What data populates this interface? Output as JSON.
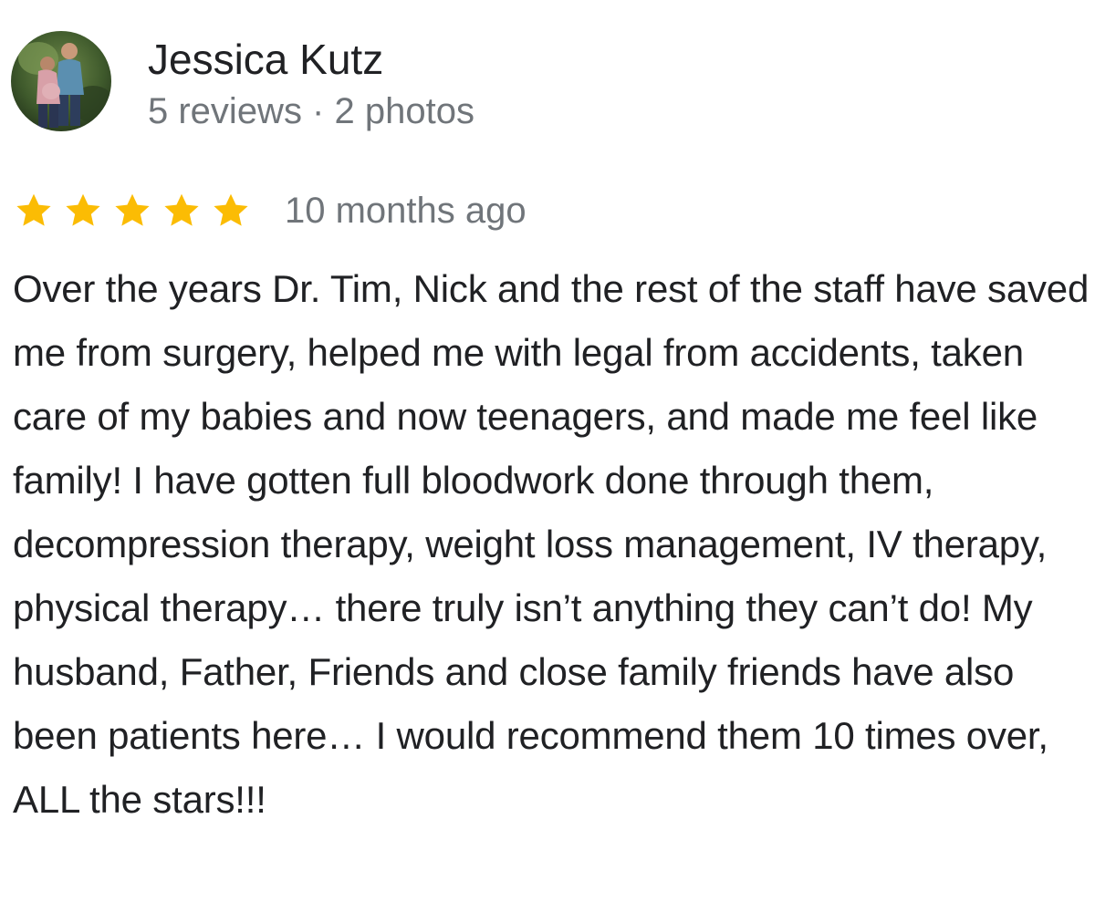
{
  "reviewer": {
    "name": "Jessica Kutz",
    "meta": "5 reviews · 2 photos",
    "avatar_icon": "profile-photo-avatar"
  },
  "rating": {
    "stars": 5,
    "max_stars": 5,
    "star_color": "#fbbc04",
    "date": "10 months ago"
  },
  "review_text": "Over the years Dr. Tim, Nick and the rest of the staff have saved me from surgery, helped me with legal from accidents, taken care of my babies and now teenagers, and made me feel like family! I have gotten full bloodwork done through them, decompression therapy, weight loss management, IV therapy, physical therapy… there truly isn’t anything they can’t do! My husband, Father, Friends and close family friends have also been patients here… I would recommend them 10 times over, ALL the stars!!!"
}
